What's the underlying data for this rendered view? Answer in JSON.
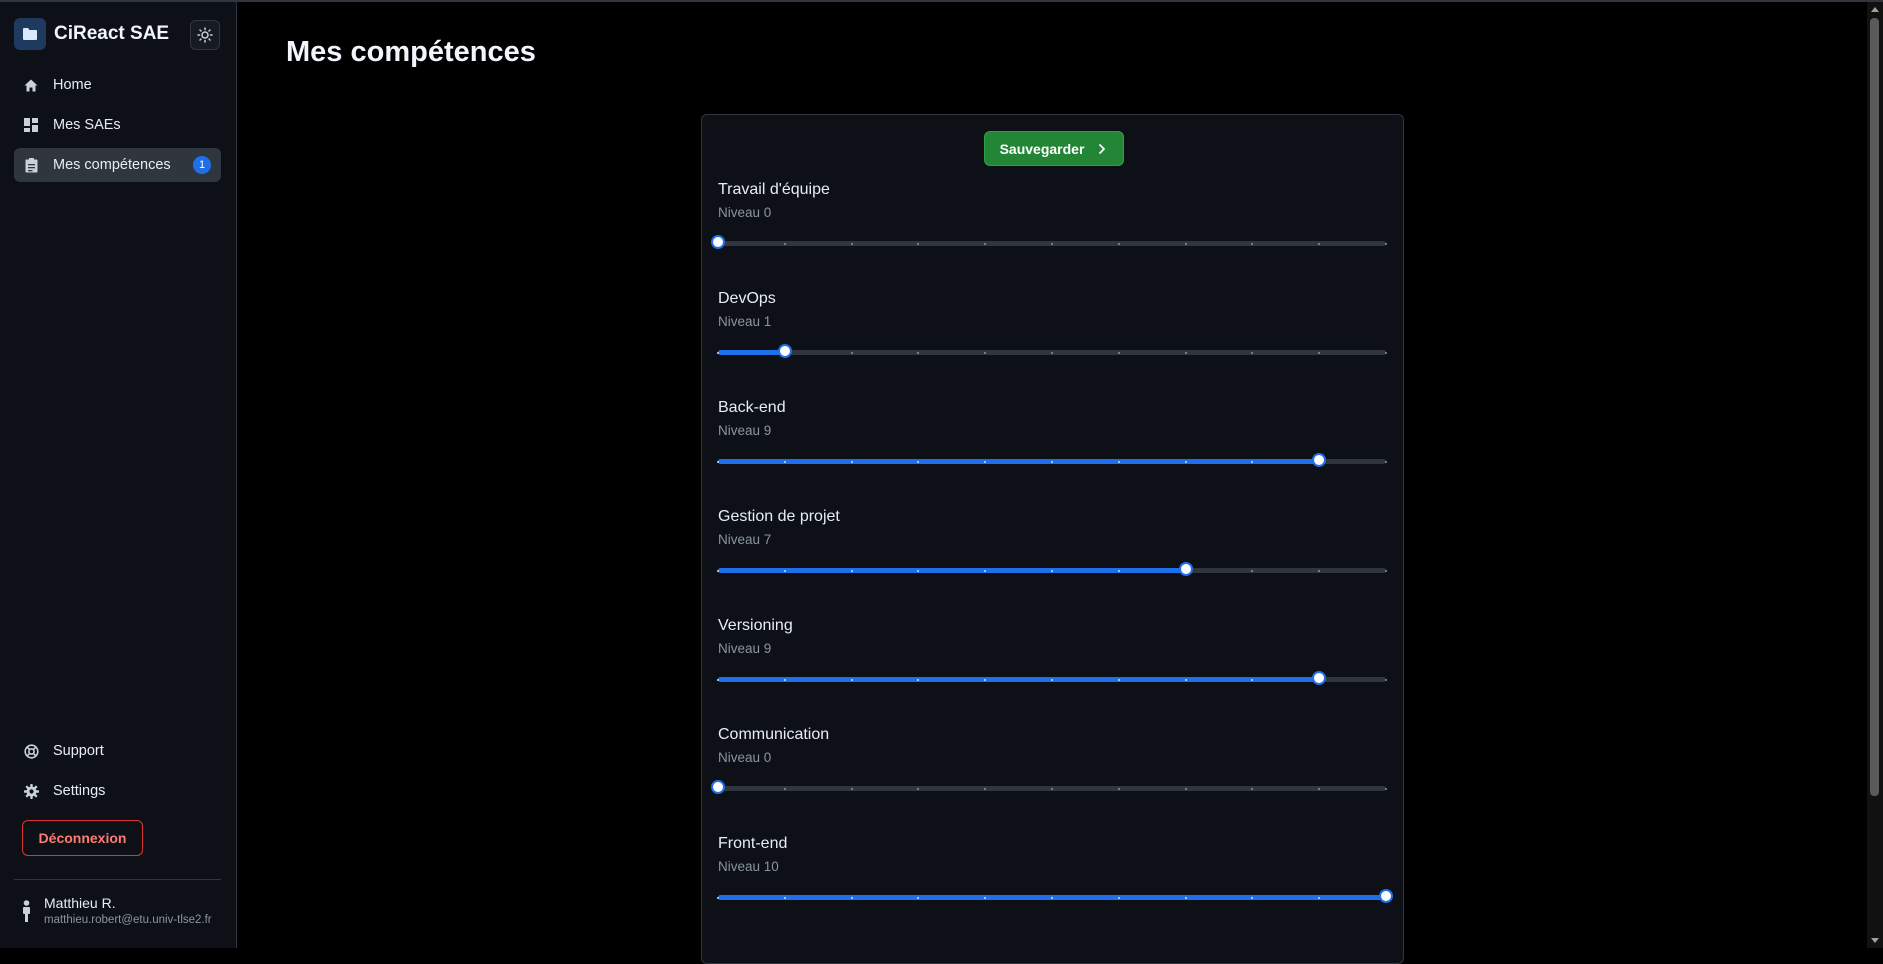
{
  "app": {
    "title": "CiReact SAE"
  },
  "sidebar": {
    "items": [
      {
        "label": "Home",
        "icon": "home-icon"
      },
      {
        "label": "Mes SAEs",
        "icon": "dashboard-icon"
      },
      {
        "label": "Mes compétences",
        "icon": "clipboard-icon",
        "badge": "1",
        "active": true
      }
    ],
    "bottom_items": [
      {
        "label": "Support",
        "icon": "support-icon"
      },
      {
        "label": "Settings",
        "icon": "gear-icon"
      }
    ],
    "logout_label": "Déconnexion",
    "user": {
      "name": "Matthieu R.",
      "email": "matthieu.robert@etu.univ-tlse2.fr"
    }
  },
  "main": {
    "title": "Mes compétences",
    "save_label": "Sauvegarder",
    "skills": [
      {
        "name": "Travail d'équipe",
        "level_label": "Niveau 0",
        "level": 0
      },
      {
        "name": "DevOps",
        "level_label": "Niveau 1",
        "level": 1
      },
      {
        "name": "Back-end",
        "level_label": "Niveau 9",
        "level": 9
      },
      {
        "name": "Gestion de projet",
        "level_label": "Niveau 7",
        "level": 7
      },
      {
        "name": "Versioning",
        "level_label": "Niveau 9",
        "level": 9
      },
      {
        "name": "Communication",
        "level_label": "Niveau 0",
        "level": 0
      },
      {
        "name": "Front-end",
        "level_label": "Niveau 10",
        "level": 10
      }
    ],
    "level_max": 10
  },
  "colors": {
    "accent": "#1f6feb",
    "save_button": "#238636",
    "logout": "#da3633"
  }
}
